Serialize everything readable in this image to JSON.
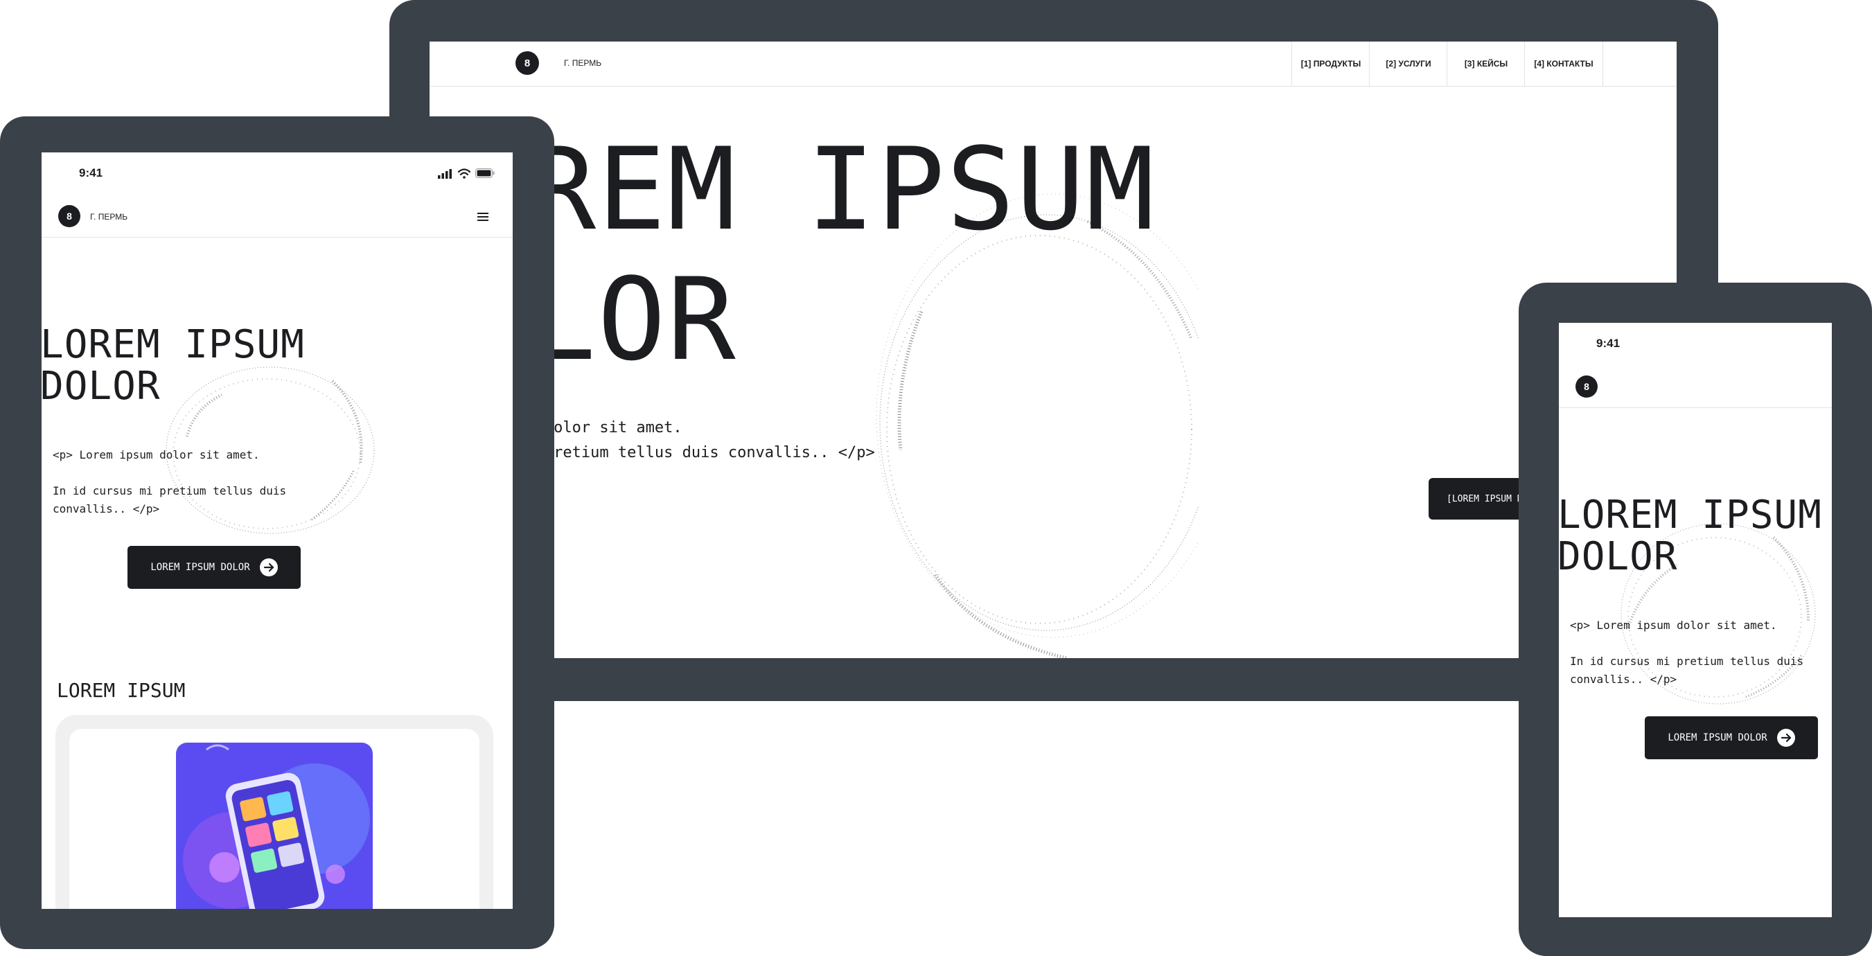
{
  "desktop": {
    "city": "Г. ПЕРМЬ",
    "nav": [
      "[1] ПРОДУКТЫ",
      "[2] УСЛУГИ",
      "[3] КЕЙСЫ",
      "[4] КОНТАКТЫ"
    ],
    "hero_line1": "LOREM IPSUM",
    "hero_line2": "DOLOR",
    "paragraph": "<p> Lorem ipsum dolor sit amet.\nIn id cursus mi pretium tellus duis convallis.. </p>",
    "cta_label": "[LOREM IPSUM DOLOR]"
  },
  "tablet": {
    "time": "9:41",
    "city": "Г. ПЕРМЬ",
    "hero_line1": "LOREM IPSUM",
    "hero_line2": "DOLOR",
    "paragraph": "<p> Lorem ipsum dolor sit amet.\n\nIn id cursus mi pretium tellus duis\nconvallis.. </p>",
    "cta_label": "LOREM IPSUM DOLOR",
    "section_title": "LOREM IPSUM"
  },
  "phone": {
    "time": "9:41",
    "hero_line1": "LOREM IPSUM",
    "hero_line2": "DOLOR",
    "paragraph": "<p> Lorem ipsum dolor sit amet.\n\nIn id cursus mi pretium tellus duis\nconvallis.. </p>",
    "cta_label": "LOREM IPSUM DOLOR"
  },
  "icons": [
    "logo-icon",
    "menu-icon",
    "arrow-right-icon",
    "signal-icon",
    "wifi-icon",
    "battery-icon"
  ],
  "colors": {
    "device_frame": "#3b4148",
    "ink": "#1c1d20",
    "background": "#ffffff",
    "illustration_bg": "#5b4cf2"
  }
}
